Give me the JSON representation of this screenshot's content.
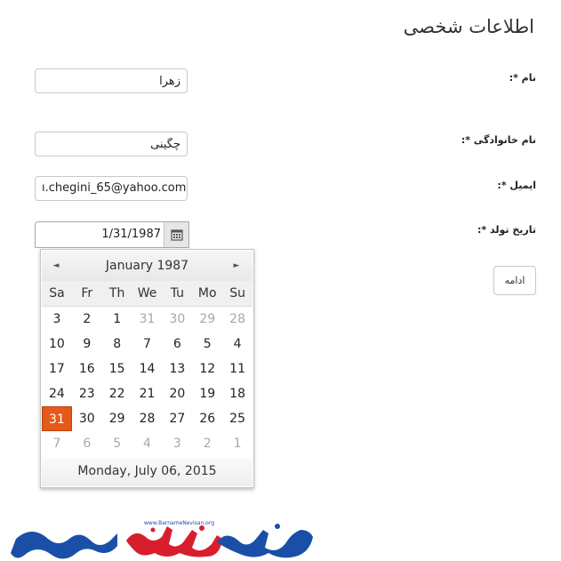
{
  "form": {
    "title": "اطلاعات شخصی",
    "first_name_label": "نام *:",
    "first_name_value": "زهرا",
    "last_name_label": "نام خانوادگی *:",
    "last_name_value": "چگینی",
    "email_label": "ایمیل *:",
    "email_value": "ı.chegini_65@yahoo.com",
    "birthdate_label": "تاریخ تولد *:",
    "birthdate_value": "1/31/1987",
    "continue_label": "ادامه"
  },
  "calendar": {
    "month_title": "January 1987",
    "prev_glyph": "◄",
    "next_glyph": "►",
    "weekdays": [
      "Sa",
      "Fr",
      "Th",
      "We",
      "Tu",
      "Mo",
      "Su"
    ],
    "weeks": [
      [
        {
          "d": "3"
        },
        {
          "d": "2"
        },
        {
          "d": "1"
        },
        {
          "d": "31",
          "muted": true
        },
        {
          "d": "30",
          "muted": true
        },
        {
          "d": "29",
          "muted": true
        },
        {
          "d": "28",
          "muted": true
        }
      ],
      [
        {
          "d": "10"
        },
        {
          "d": "9"
        },
        {
          "d": "8"
        },
        {
          "d": "7"
        },
        {
          "d": "6"
        },
        {
          "d": "5"
        },
        {
          "d": "4"
        }
      ],
      [
        {
          "d": "17"
        },
        {
          "d": "16"
        },
        {
          "d": "15"
        },
        {
          "d": "14"
        },
        {
          "d": "13"
        },
        {
          "d": "12"
        },
        {
          "d": "11"
        }
      ],
      [
        {
          "d": "24"
        },
        {
          "d": "23"
        },
        {
          "d": "22"
        },
        {
          "d": "21"
        },
        {
          "d": "20"
        },
        {
          "d": "19"
        },
        {
          "d": "18"
        }
      ],
      [
        {
          "d": "31",
          "selected": true
        },
        {
          "d": "30"
        },
        {
          "d": "29"
        },
        {
          "d": "28"
        },
        {
          "d": "27"
        },
        {
          "d": "26"
        },
        {
          "d": "25"
        }
      ],
      [
        {
          "d": "7",
          "muted": true
        },
        {
          "d": "6",
          "muted": true
        },
        {
          "d": "5",
          "muted": true
        },
        {
          "d": "4",
          "muted": true
        },
        {
          "d": "3",
          "muted": true
        },
        {
          "d": "2",
          "muted": true
        },
        {
          "d": "1",
          "muted": true
        }
      ]
    ],
    "today_text": "Monday, July 06, 2015"
  },
  "logo": {
    "site_text": "www.BarnameNevisan.org",
    "brand_colors": {
      "blue": "#1a4fa8",
      "red": "#d81e2c"
    }
  },
  "icons": {
    "date_picker": "calendar-icon"
  }
}
